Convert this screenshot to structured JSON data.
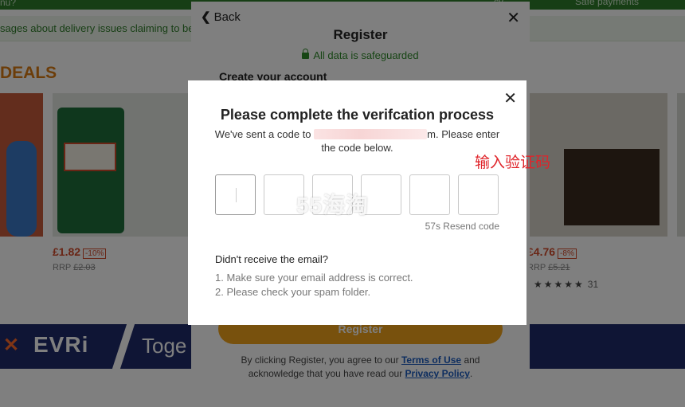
{
  "background": {
    "topbar": {
      "left": "nu?",
      "right1": "cy",
      "right2": "Safe payments"
    },
    "notice": "sages about delivery issues claiming to be",
    "deals_title": "DEALS",
    "products": [
      {
        "price": "£1.82",
        "discount": "-10%",
        "rrp_label": "RRP",
        "rrp": "£2.03"
      },
      {
        "price": "£4.76",
        "discount": "-8%",
        "rrp_label": "RRP",
        "rrp": "£5.21",
        "stars": "★★★★★",
        "reviews": "31"
      }
    ],
    "banner": {
      "x": "✕",
      "brand": "EVRi",
      "text": "Toge"
    }
  },
  "register": {
    "back_label": "Back",
    "close": "✕",
    "title": "Register",
    "safe_text": "All data is safeguarded",
    "create_heading": "Create your account",
    "register_button": "Register",
    "terms_prefix": "By clicking Register, you agree to our ",
    "terms_link": "Terms of Use",
    "terms_mid": " and acknowledge that you have read our ",
    "privacy_link": "Privacy Policy",
    "terms_suffix": "."
  },
  "verify": {
    "close": "✕",
    "title": "Please complete the verifcation process",
    "sent_prefix": "We've sent a code to ",
    "sent_tail": "m. Please enter the code below.",
    "code_boxes": 6,
    "resend": "57s Resend code",
    "help_heading": "Didn't receive the email?",
    "tips": [
      "1. Make sure your email address is correct.",
      "2. Please check your spam folder."
    ]
  },
  "watermark": "55海淘",
  "annotation": "输入验证码",
  "colors": {
    "accent_green": "#2f8a2a",
    "orange": "#f0a21a",
    "link_blue": "#1b5bbf"
  }
}
